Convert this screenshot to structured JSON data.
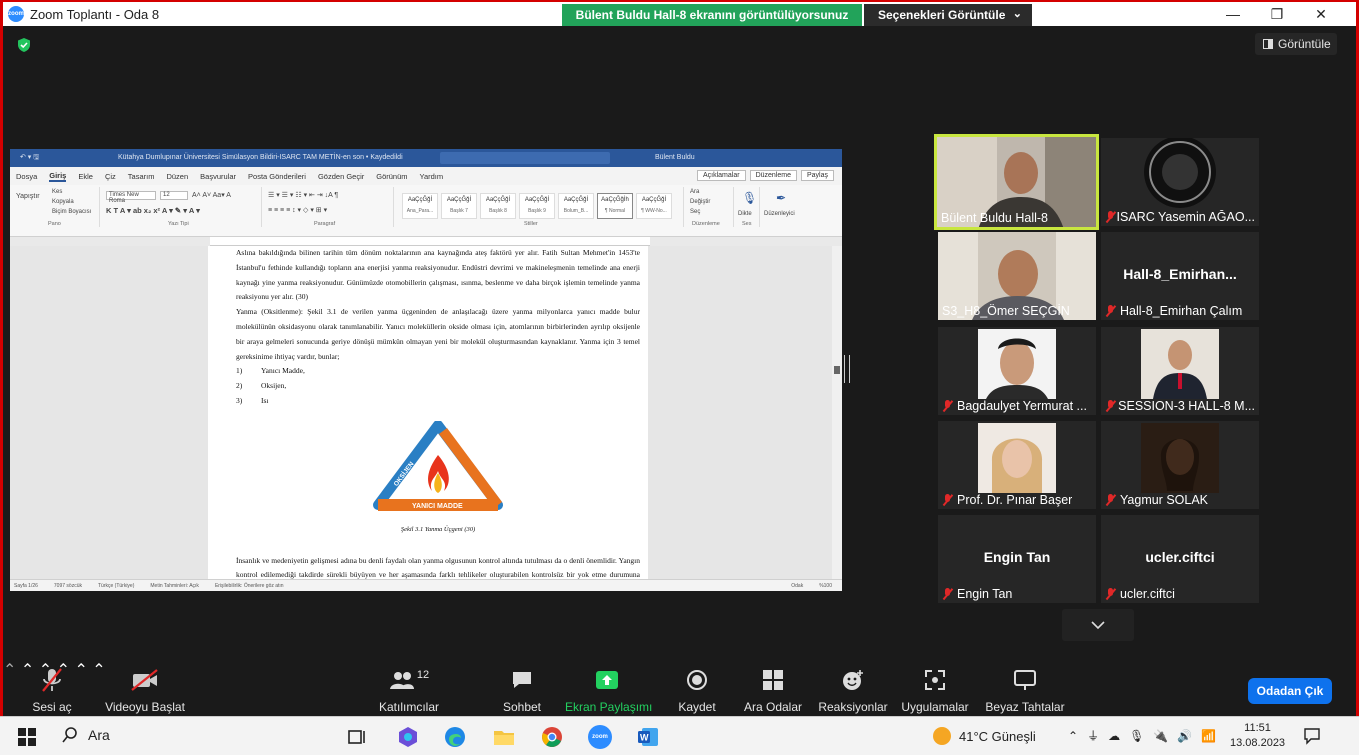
{
  "window": {
    "title": "Zoom Toplantı - Oda 8",
    "share_banner": "Bülent Buldu Hall-8 ekranını görüntülüyorsunuz",
    "view_options": "Seçenekleri Görüntüle",
    "gallery_button": "Görüntüle"
  },
  "word": {
    "doc_title": "Kütahya Dumlupınar Üniversitesi Simülasyon Bildiri-ISARC TAM METİN-en son • Kaydedildi",
    "user": "Bülent Buldu",
    "menu": [
      "Dosya",
      "Giriş",
      "Ekle",
      "Çiz",
      "Tasarım",
      "Düzen",
      "Başvurular",
      "Posta Gönderileri",
      "Gözden Geçir",
      "Görünüm",
      "Yardım"
    ],
    "menu_right": [
      "Açıklamalar",
      "Düzenleme",
      "Paylaş"
    ],
    "ribbon_groups": [
      "Pano",
      "Yazı Tipi",
      "Paragraf",
      "Stiller",
      "Düzenleme",
      "Ses",
      "Düzenleyici"
    ],
    "font_name": "Times New Roma",
    "font_size": "12",
    "clipboard": {
      "paste": "Yapıştır",
      "cut": "Kes",
      "copy": "Kopyala",
      "format": "Biçim Boyacısı"
    },
    "styles": [
      {
        "sample": "AaÇçĞğİ",
        "name": "Ana_Para..."
      },
      {
        "sample": "AaÇçĞğİ",
        "name": "Başlık 7"
      },
      {
        "sample": "AaÇçĞğİ",
        "name": "Başlık 8"
      },
      {
        "sample": "AaÇçĞğİ",
        "name": "Başlık 9"
      },
      {
        "sample": "AaÇçĞğİ",
        "name": "Bolum_B..."
      },
      {
        "sample": "AaÇçĞğİh",
        "name": "¶ Normal"
      },
      {
        "sample": "AaÇçĞğİ",
        "name": "¶ WW-No..."
      }
    ],
    "editing": {
      "find": "Ara",
      "replace": "Değiştir",
      "select": "Seç"
    },
    "dictate": "Dikte",
    "editor": "Düzenleyici",
    "paragraphs": {
      "p1": "Aslına bakıldığında bilinen tarihin tüm dönüm noktalarının ana kaynağında ateş faktörü yer alır. Fatih Sultan Mehmet'in 1453'te İstanbul'u fethinde kullandığı topların ana enerjisi yanma reaksiyonudur. Endüstri devrimi ve makineleşmenin temelinde ana enerji kaynağı yine yanma reaksiyonudur. Günümüzde otomobillerin çalışması, ısınma, beslenme ve daha birçok işlemin temelinde yanma reaksiyonu yer alır. (30)",
      "p2": "Yanma (Oksitlenme): Şekil 3.1 de verilen yanma üçgeninden de anlaşılacağı üzere yanma milyonlarca yanıcı madde bulur molekülünün oksidasyonu olarak tanımlanabilir. Yanıcı moleküllerin okside olması için, atomlarının birbirlerinden ayrılıp oksijenle bir araya gelmeleri sonucunda geriye dönüşü mümkün olmayan yeni bir molekül oluşturmasından kaynaklanır. Yanma için 3 temel gereksinime ihtiyaç vardır, bunlar;",
      "list": [
        {
          "num": "1)",
          "text": "Yanıcı Madde,"
        },
        {
          "num": "2)",
          "text": "Oksijen,"
        },
        {
          "num": "3)",
          "text": "Isı"
        }
      ],
      "figure_left": "OKSİJEN",
      "figure_right": "SICAKLIK",
      "figure_bottom": "YANICI MADDE",
      "caption": "Şekil 3.1 Yanma Üçgeni (30)",
      "p3": "İnsanlık ve medeniyetin gelişmesi adına bu denli faydalı olan yanma olgusunun kontrol altında tutulması da o denli önemlidir. Yangın kontrol edilemediği takdirde sürekli büyüyen ve her aşamasında farklı tehlikeler oluşturabilen kontrolsüz bir yok etme durumuna dönüşür. Yangın adeta yok etmeye programlanmıştır. (30)"
    },
    "status": [
      "Sayfa 1/26",
      "7097 sözcük",
      "Türkçe (Türkiye)",
      "Metin Tahminleri: Açık",
      "Erişilebilirlik: Önerilere göz atın",
      "Odak",
      "%100"
    ]
  },
  "participants": [
    {
      "name": "Bülent Buldu Hall-8",
      "muted": false,
      "video": true
    },
    {
      "name": "ISARC Yasemin AĞAO...",
      "muted": true,
      "video": true
    },
    {
      "name": "S3_H8_Ömer SEÇGİN",
      "muted": false,
      "video": true
    },
    {
      "name": "Hall-8_Emirhan Çalım",
      "muted": true,
      "video": false,
      "display": "Hall-8_Emirhan..."
    },
    {
      "name": "Bagdaulyet Yermurat ...",
      "muted": true,
      "video": true
    },
    {
      "name": "SESSION-3 HALL-8 M...",
      "muted": true,
      "video": true
    },
    {
      "name": "Prof. Dr. Pınar Başer",
      "muted": true,
      "video": true
    },
    {
      "name": "Yagmur SOLAK",
      "muted": true,
      "video": true
    },
    {
      "name": "Engin Tan",
      "muted": true,
      "video": false,
      "display": "Engin Tan"
    },
    {
      "name": "ucler.ciftci",
      "muted": true,
      "video": false,
      "display": "ucler.ciftci"
    }
  ],
  "toolbar": {
    "mute": "Sesi aç",
    "video": "Videoyu Başlat",
    "participants": "Katılımcılar",
    "participants_count": "12",
    "chat": "Sohbet",
    "share": "Ekran Paylaşımı",
    "record": "Kaydet",
    "breakout": "Ara Odalar",
    "reactions": "Reaksiyonlar",
    "apps": "Uygulamalar",
    "whiteboards": "Beyaz Tahtalar",
    "leave": "Odadan Çık"
  },
  "taskbar": {
    "search": "Ara",
    "weather": "41°C Güneşli",
    "time": "11:51",
    "date": "13.08.2023",
    "zoom_label": "zoom"
  },
  "colors": {
    "accent": "#0e72ed",
    "share_green": "#22a35a",
    "active_speaker": "#c8e63f",
    "muted": "#e02828"
  }
}
